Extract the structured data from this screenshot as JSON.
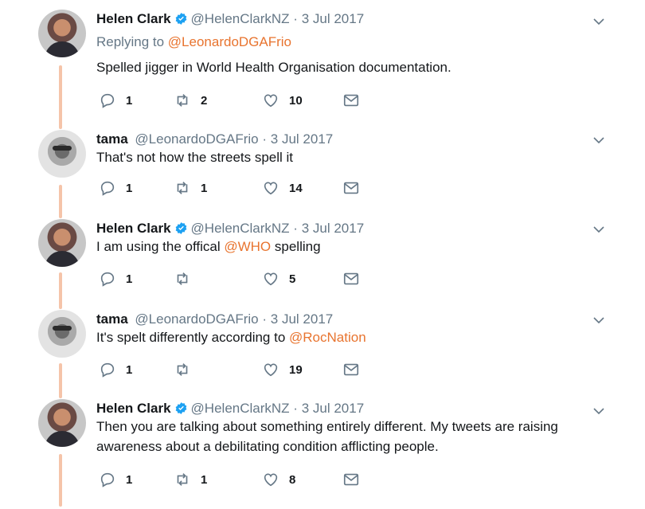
{
  "tweets": [
    {
      "author": "Helen Clark",
      "verified": true,
      "handle": "@HelenClarkNZ",
      "separator": "·",
      "date": "3 Jul 2017",
      "replying_prefix": "Replying to",
      "replying_to": "@LeonardoDGAFrio",
      "text": "Spelled jigger in World Health Organisation documentation.",
      "replies": "1",
      "retweets": "2",
      "likes": "10"
    },
    {
      "author": "tama",
      "verified": false,
      "handle": "@LeonardoDGAFrio",
      "separator": "·",
      "date": "3 Jul 2017",
      "text": "That's not how the streets spell it",
      "replies": "1",
      "retweets": "1",
      "likes": "14"
    },
    {
      "author": "Helen Clark",
      "verified": true,
      "handle": "@HelenClarkNZ",
      "separator": "·",
      "date": "3 Jul 2017",
      "text_before": "I am using the offical",
      "mention": "@WHO",
      "text_after": "spelling",
      "replies": "1",
      "retweets": "",
      "likes": "5"
    },
    {
      "author": "tama",
      "verified": false,
      "handle": "@LeonardoDGAFrio",
      "separator": "·",
      "date": "3 Jul 2017",
      "text_before": "It's spelt differently according to",
      "mention": "@RocNation",
      "replies": "1",
      "retweets": "",
      "likes": "19"
    },
    {
      "author": "Helen Clark",
      "verified": true,
      "handle": "@HelenClarkNZ",
      "separator": "·",
      "date": "3 Jul 2017",
      "text": "Then you are talking about something entirely different. My tweets are raising awareness about a debilitating condition afflicting people.",
      "replies": "1",
      "retweets": "1",
      "likes": "8"
    }
  ],
  "colors": {
    "mention": "#e8742f",
    "thread_line": "#f5c4a9",
    "muted": "#657786",
    "verified": "#1da1f2"
  },
  "icons": [
    "reply-icon",
    "retweet-icon",
    "like-icon",
    "direct-message-icon",
    "caret-down-icon",
    "verified-badge-icon"
  ]
}
